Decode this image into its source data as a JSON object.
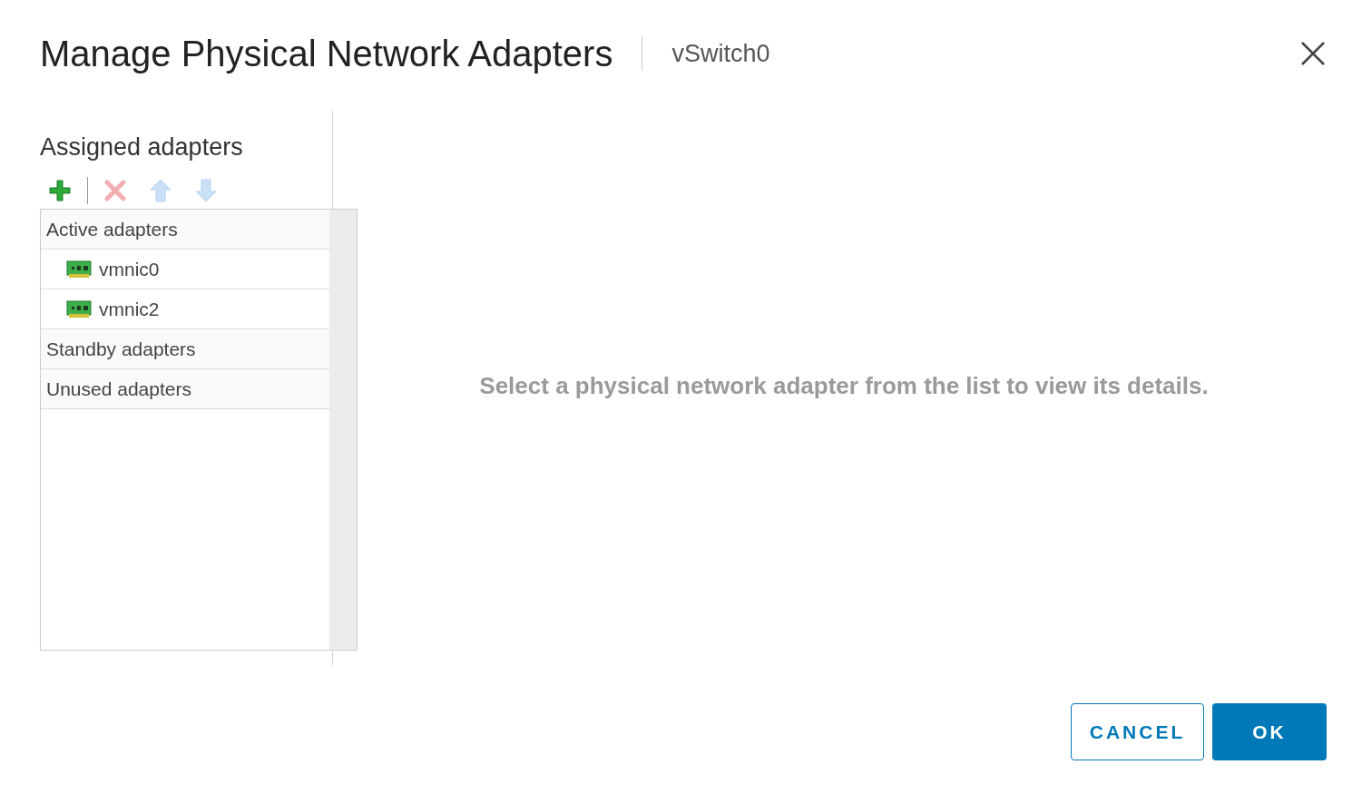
{
  "dialog": {
    "title": "Manage Physical Network Adapters",
    "subtitle": "vSwitch0"
  },
  "panel": {
    "heading": "Assigned adapters",
    "toolbar": [
      {
        "kind": "add",
        "disabled": false
      },
      {
        "kind": "remove",
        "disabled": true
      },
      {
        "kind": "up",
        "disabled": true
      },
      {
        "kind": "down",
        "disabled": true
      }
    ],
    "rows": [
      {
        "kind": "group",
        "label": "Active adapters"
      },
      {
        "kind": "adapter",
        "label": "vmnic0"
      },
      {
        "kind": "adapter",
        "label": "vmnic2"
      },
      {
        "kind": "group",
        "label": "Standby adapters"
      },
      {
        "kind": "group",
        "label": "Unused adapters"
      }
    ]
  },
  "details": {
    "message": "Select a physical network adapter from the list to view its details."
  },
  "buttons": [
    {
      "kind": "secondary",
      "label": "CANCEL"
    },
    {
      "kind": "primary",
      "label": "OK"
    }
  ]
}
